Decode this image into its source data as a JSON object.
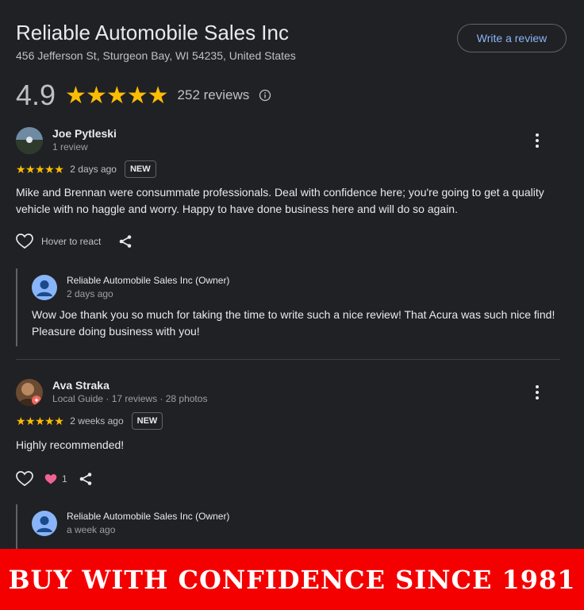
{
  "business": {
    "name": "Reliable Automobile Sales Inc",
    "address": "456 Jefferson St, Sturgeon Bay, WI 54235, United States",
    "write_review_label": "Write a review",
    "rating": "4.9",
    "stars": "★★★★★",
    "review_count": "252 reviews"
  },
  "reviews": [
    {
      "name": "Joe Pytleski",
      "meta": "1 review",
      "stars": "★★★★★",
      "time": "2 days ago",
      "badge": "NEW",
      "text": "Mike and Brennan were consummate professionals. Deal with confidence here; you're going to get a quality vehicle with no haggle and worry. Happy to have done business here and will do so again.",
      "react_label": "Hover to react",
      "reply": {
        "name": "Reliable Automobile Sales Inc (Owner)",
        "time": "2 days ago",
        "text": "Wow Joe thank you so much for taking the time to write such a nice review! That Acura was such nice find! Pleasure doing business with you!"
      }
    },
    {
      "name": "Ava Straka",
      "meta": "Local Guide · 17 reviews · 28 photos",
      "stars": "★★★★★",
      "time": "2 weeks ago",
      "badge": "NEW",
      "text": "Highly recommended!",
      "reaction_count": "1",
      "reply": {
        "name": "Reliable Automobile Sales Inc (Owner)",
        "time": "a week ago"
      }
    }
  ],
  "banner": {
    "text": "BUY WITH CONFIDENCE SINCE 1981"
  },
  "colors": {
    "background": "#202124",
    "star": "#fbbc04",
    "link": "#8ab4f8",
    "banner": "#f40000",
    "heart": "#f06292"
  }
}
